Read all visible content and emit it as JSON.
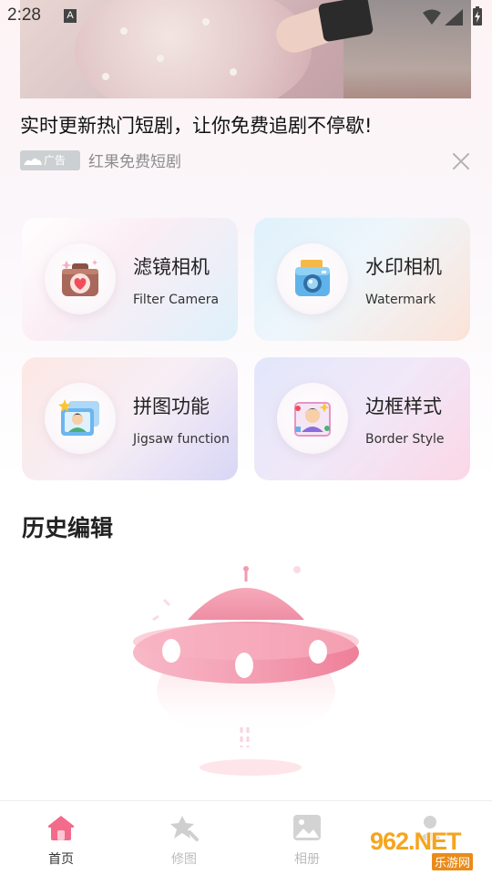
{
  "status_bar": {
    "time": "2:28",
    "notification_letter": "A"
  },
  "ad": {
    "title": "实时更新热门短剧，让你免费追剧不停歇!",
    "badge_label": "广告",
    "source": "红果免费短剧"
  },
  "features": [
    {
      "title": "滤镜相机",
      "subtitle": "Filter Camera",
      "icon": "heart-camera-icon"
    },
    {
      "title": "水印相机",
      "subtitle": "Watermark",
      "icon": "instant-camera-icon"
    },
    {
      "title": "拼图功能",
      "subtitle": "Jigsaw function",
      "icon": "photo-collage-icon"
    },
    {
      "title": "边框样式",
      "subtitle": "Border Style",
      "icon": "portrait-frame-icon"
    }
  ],
  "history": {
    "title": "历史编辑"
  },
  "bottom_nav": [
    {
      "label": "首页",
      "icon": "home-icon",
      "active": true
    },
    {
      "label": "修图",
      "icon": "star-edit-icon",
      "active": false
    },
    {
      "label": "相册",
      "icon": "gallery-icon",
      "active": false
    },
    {
      "label": "",
      "icon": "person-icon",
      "active": false
    }
  ],
  "watermark_logo": {
    "text": "962.NET",
    "sub": "乐游网"
  },
  "colors": {
    "accent": "#f26b8a",
    "text": "#222222",
    "muted": "#bcbcbc"
  }
}
